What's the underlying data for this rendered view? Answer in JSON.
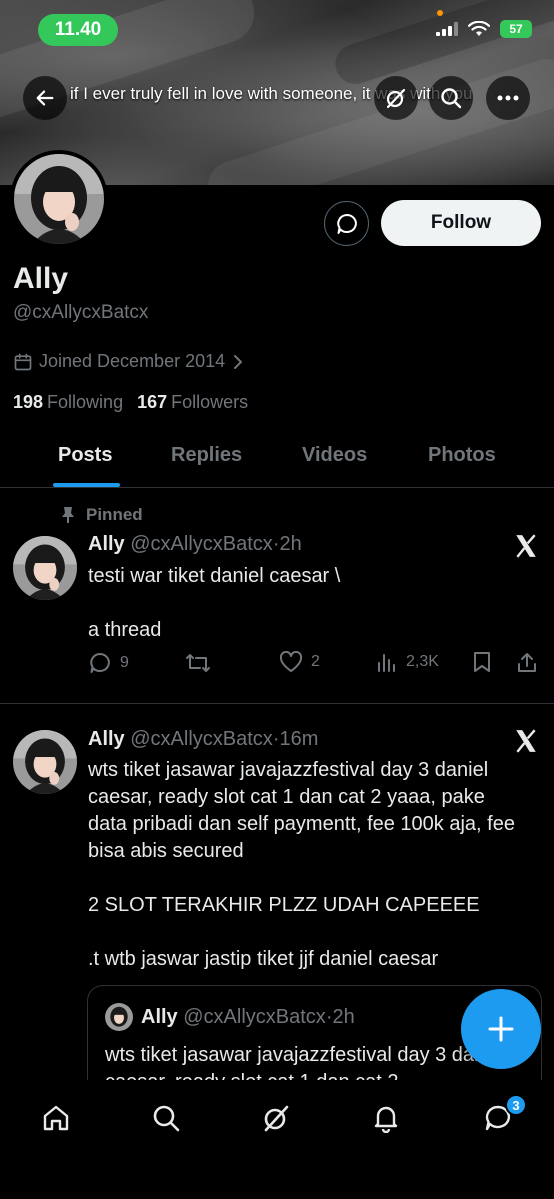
{
  "status_bar": {
    "time": "11.40",
    "battery": "57"
  },
  "banner": {
    "text": "if I ever truly fell in love with someone, it was with you"
  },
  "profile": {
    "name": "Ally",
    "handle": "@cxAllycxBatcx",
    "joined": "Joined December 2014",
    "following_count": "198",
    "following_label": "Following",
    "followers_count": "167",
    "followers_label": "Followers",
    "follow_label": "Follow"
  },
  "tabs": [
    {
      "label": "Posts",
      "active": true
    },
    {
      "label": "Replies",
      "active": false
    },
    {
      "label": "Videos",
      "active": false
    },
    {
      "label": "Photos",
      "active": false
    }
  ],
  "posts": [
    {
      "pinned_label": "Pinned",
      "name": "Ally",
      "handle": "@cxAllycxBatcx",
      "time": "2h",
      "text": "testi war tiket daniel caesar \\\n\na thread",
      "replies": "9",
      "likes": "2",
      "views": "2,3K"
    },
    {
      "name": "Ally",
      "handle": "@cxAllycxBatcx",
      "time": "16m",
      "text": "wts tiket jasawar javajazzfestival day 3 daniel caesar, ready slot cat 1 dan cat 2 yaaa, pake data pribadi dan self paymentt, fee 100k aja, fee bisa abis secured\n\n2 SLOT TERAKHIR PLZZ UDAH CAPEEEE\n\n.t wtb jaswar jastip tiket jjf daniel caesar",
      "quote": {
        "name": "Ally",
        "handle": "@cxAllycxBatcx",
        "time": "2h",
        "text": "wts tiket jasawar javajazzfestival day 3 daniel caesar, ready slot cat 1 dan cat 2"
      }
    }
  ],
  "nav": {
    "messages_badge": "3"
  },
  "colors": {
    "accent": "#1d9bf0",
    "background": "#000000",
    "muted": "#71767b",
    "status_green": "#34c759"
  }
}
